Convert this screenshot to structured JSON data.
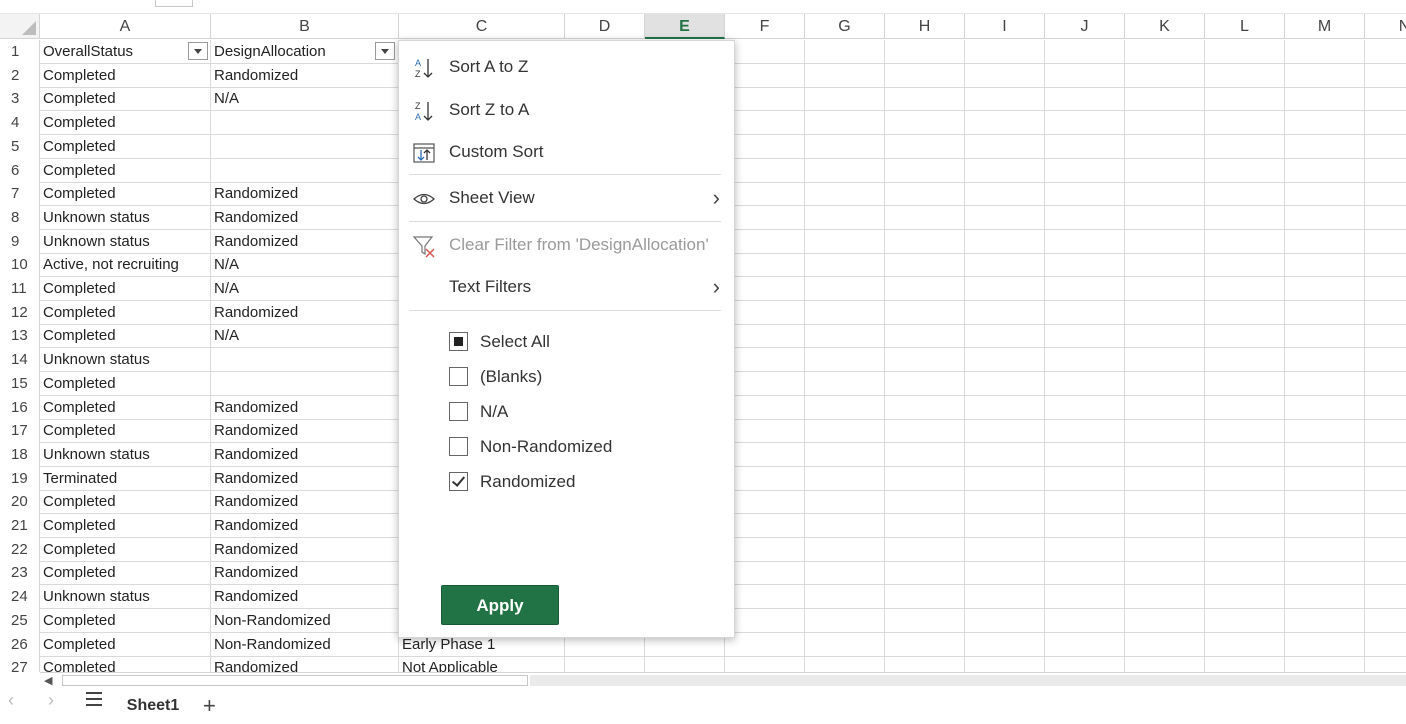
{
  "columns": [
    "A",
    "B",
    "C",
    "D",
    "E",
    "F",
    "G",
    "H",
    "I",
    "J",
    "K",
    "L",
    "M",
    "N"
  ],
  "selected_column": "E",
  "header_row": {
    "A": "OverallStatus",
    "B": "DesignAllocation",
    "C": ""
  },
  "rows": [
    {
      "n": "1",
      "a": "OverallStatus",
      "b": "DesignAllocation",
      "c": ""
    },
    {
      "n": "2",
      "a": "Completed",
      "b": "Randomized",
      "c": ""
    },
    {
      "n": "3",
      "a": "Completed",
      "b": "N/A",
      "c": ""
    },
    {
      "n": "4",
      "a": "Completed",
      "b": "",
      "c": ""
    },
    {
      "n": "5",
      "a": "Completed",
      "b": "",
      "c": ""
    },
    {
      "n": "6",
      "a": "Completed",
      "b": "",
      "c": ""
    },
    {
      "n": "7",
      "a": "Completed",
      "b": "Randomized",
      "c": ""
    },
    {
      "n": "8",
      "a": "Unknown status",
      "b": "Randomized",
      "c": ""
    },
    {
      "n": "9",
      "a": "Unknown status",
      "b": "Randomized",
      "c": ""
    },
    {
      "n": "10",
      "a": "Active, not recruiting",
      "b": "N/A",
      "c": ""
    },
    {
      "n": "11",
      "a": "Completed",
      "b": "N/A",
      "c": ""
    },
    {
      "n": "12",
      "a": "Completed",
      "b": "Randomized",
      "c": ""
    },
    {
      "n": "13",
      "a": "Completed",
      "b": "N/A",
      "c": ""
    },
    {
      "n": "14",
      "a": "Unknown status",
      "b": "",
      "c": ""
    },
    {
      "n": "15",
      "a": "Completed",
      "b": "",
      "c": ""
    },
    {
      "n": "16",
      "a": "Completed",
      "b": "Randomized",
      "c": ""
    },
    {
      "n": "17",
      "a": "Completed",
      "b": "Randomized",
      "c": ""
    },
    {
      "n": "18",
      "a": "Unknown status",
      "b": "Randomized",
      "c": ""
    },
    {
      "n": "19",
      "a": "Terminated",
      "b": "Randomized",
      "c": ""
    },
    {
      "n": "20",
      "a": "Completed",
      "b": "Randomized",
      "c": ""
    },
    {
      "n": "21",
      "a": "Completed",
      "b": "Randomized",
      "c": ""
    },
    {
      "n": "22",
      "a": "Completed",
      "b": "Randomized",
      "c": ""
    },
    {
      "n": "23",
      "a": "Completed",
      "b": "Randomized",
      "c": ""
    },
    {
      "n": "24",
      "a": "Unknown status",
      "b": "Randomized",
      "c": ""
    },
    {
      "n": "25",
      "a": "Completed",
      "b": "Non-Randomized",
      "c": ""
    },
    {
      "n": "26",
      "a": "Completed",
      "b": "Non-Randomized",
      "c": "Early Phase 1"
    },
    {
      "n": "27",
      "a": "Completed",
      "b": "Randomized",
      "c": "Not Applicable"
    }
  ],
  "menu": {
    "sort_az": "Sort A to Z",
    "sort_za": "Sort Z to A",
    "custom_sort": "Custom Sort",
    "sheet_view": "Sheet View",
    "clear_filter": "Clear Filter from 'DesignAllocation'",
    "text_filters": "Text Filters",
    "options": [
      {
        "label": "Select All",
        "state": "partial"
      },
      {
        "label": "(Blanks)",
        "state": "unchecked"
      },
      {
        "label": "N/A",
        "state": "unchecked"
      },
      {
        "label": "Non-Randomized",
        "state": "unchecked"
      },
      {
        "label": "Randomized",
        "state": "checked"
      }
    ],
    "apply_label": "Apply"
  },
  "sheet_tab": "Sheet1",
  "colors": {
    "accent": "#217346",
    "grid": "#dadada"
  }
}
